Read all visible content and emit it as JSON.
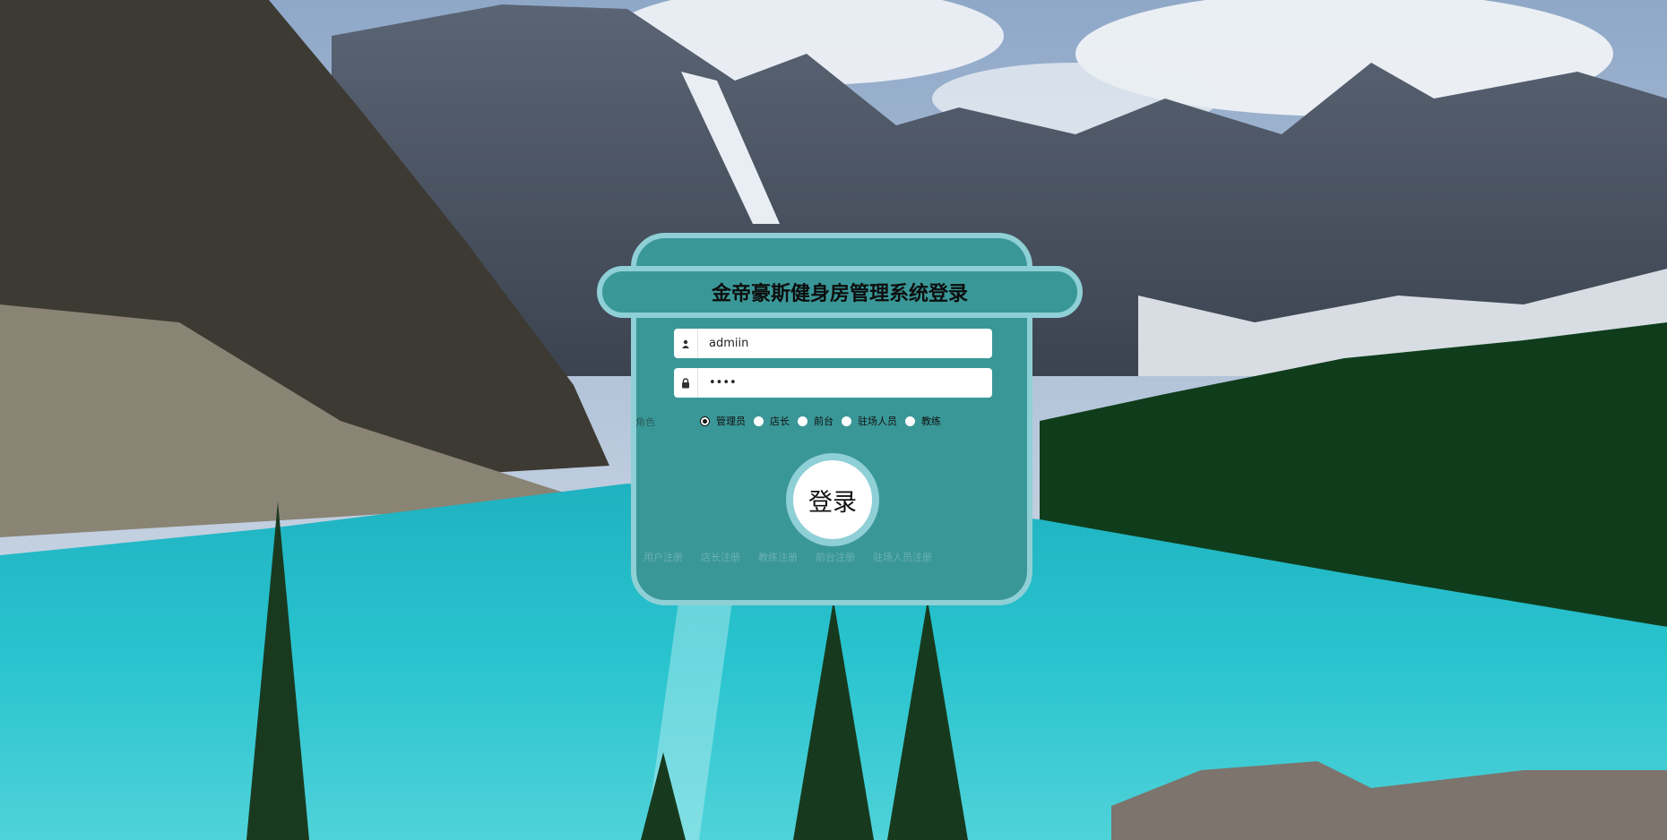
{
  "title": "金帝豪斯健身房管理系统登录",
  "username": {
    "value": "admiin",
    "icon": "user-icon"
  },
  "password": {
    "value": "••••",
    "icon": "lock-icon"
  },
  "role": {
    "label": "角色",
    "options": [
      "管理员",
      "店长",
      "前台",
      "驻场人员",
      "教练"
    ],
    "selected": "管理员"
  },
  "login_button": "登录",
  "register_links": [
    "用户注册",
    "店长注册",
    "教练注册",
    "前台注册",
    "驻场人员注册"
  ],
  "colors": {
    "card": "#3a9797",
    "border": "#8fcfd6",
    "link": "#6bb0b3"
  }
}
